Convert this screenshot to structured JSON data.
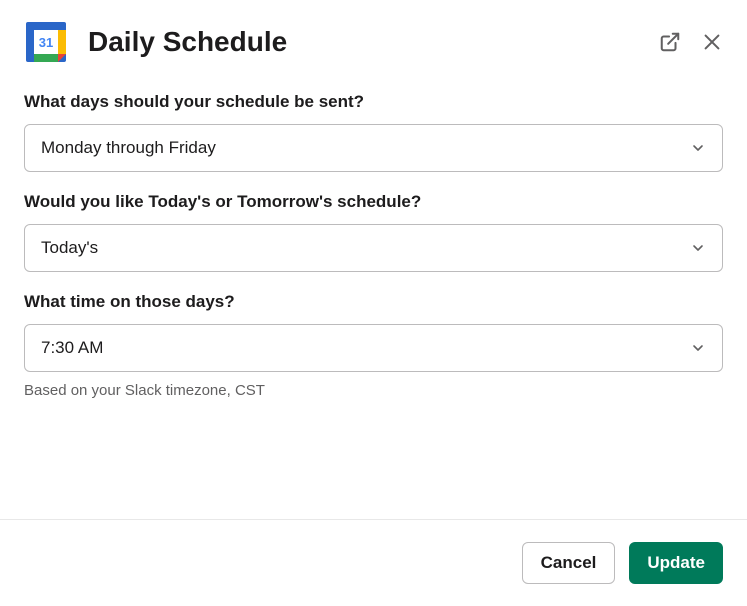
{
  "header": {
    "title": "Daily Schedule",
    "calendar_day": "31"
  },
  "fields": {
    "days": {
      "label": "What days should your schedule be sent?",
      "value": "Monday through Friday"
    },
    "which": {
      "label": "Would you like Today's or Tomorrow's schedule?",
      "value": "Today's"
    },
    "time": {
      "label": "What time on those days?",
      "value": "7:30 AM",
      "helper": "Based on your Slack timezone, CST"
    }
  },
  "footer": {
    "cancel_label": "Cancel",
    "update_label": "Update"
  }
}
